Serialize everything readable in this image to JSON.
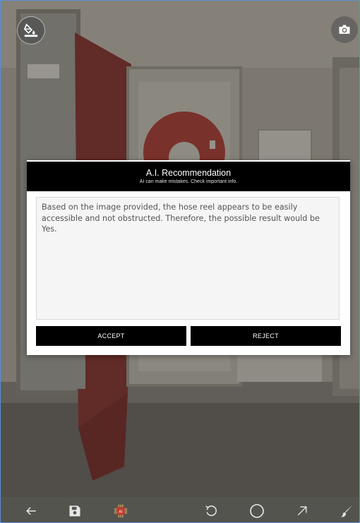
{
  "dialog": {
    "title": "A.I. Recommendation",
    "subtitle": "AI can make mistakes. Check important info.",
    "body": "Based on the image provided, the hose reel appears to be easily accessible and not obstructed. Therefore, the possible result would be Yes.",
    "accept_label": "ACCEPT",
    "reject_label": "REJECT"
  },
  "photo_overlay": {
    "line1": "...",
    "line2": "..."
  },
  "toolbar": {
    "icons": [
      "back-arrow-icon",
      "save-icon",
      "ai-chip-icon",
      "undo-icon",
      "circle-tool-icon",
      "arrow-tool-icon",
      "brush-tool-icon"
    ]
  },
  "colors": {
    "dialog_header": "#000000",
    "toolbar_bg": "#54544f",
    "frame_border": "#5b8fd6"
  }
}
